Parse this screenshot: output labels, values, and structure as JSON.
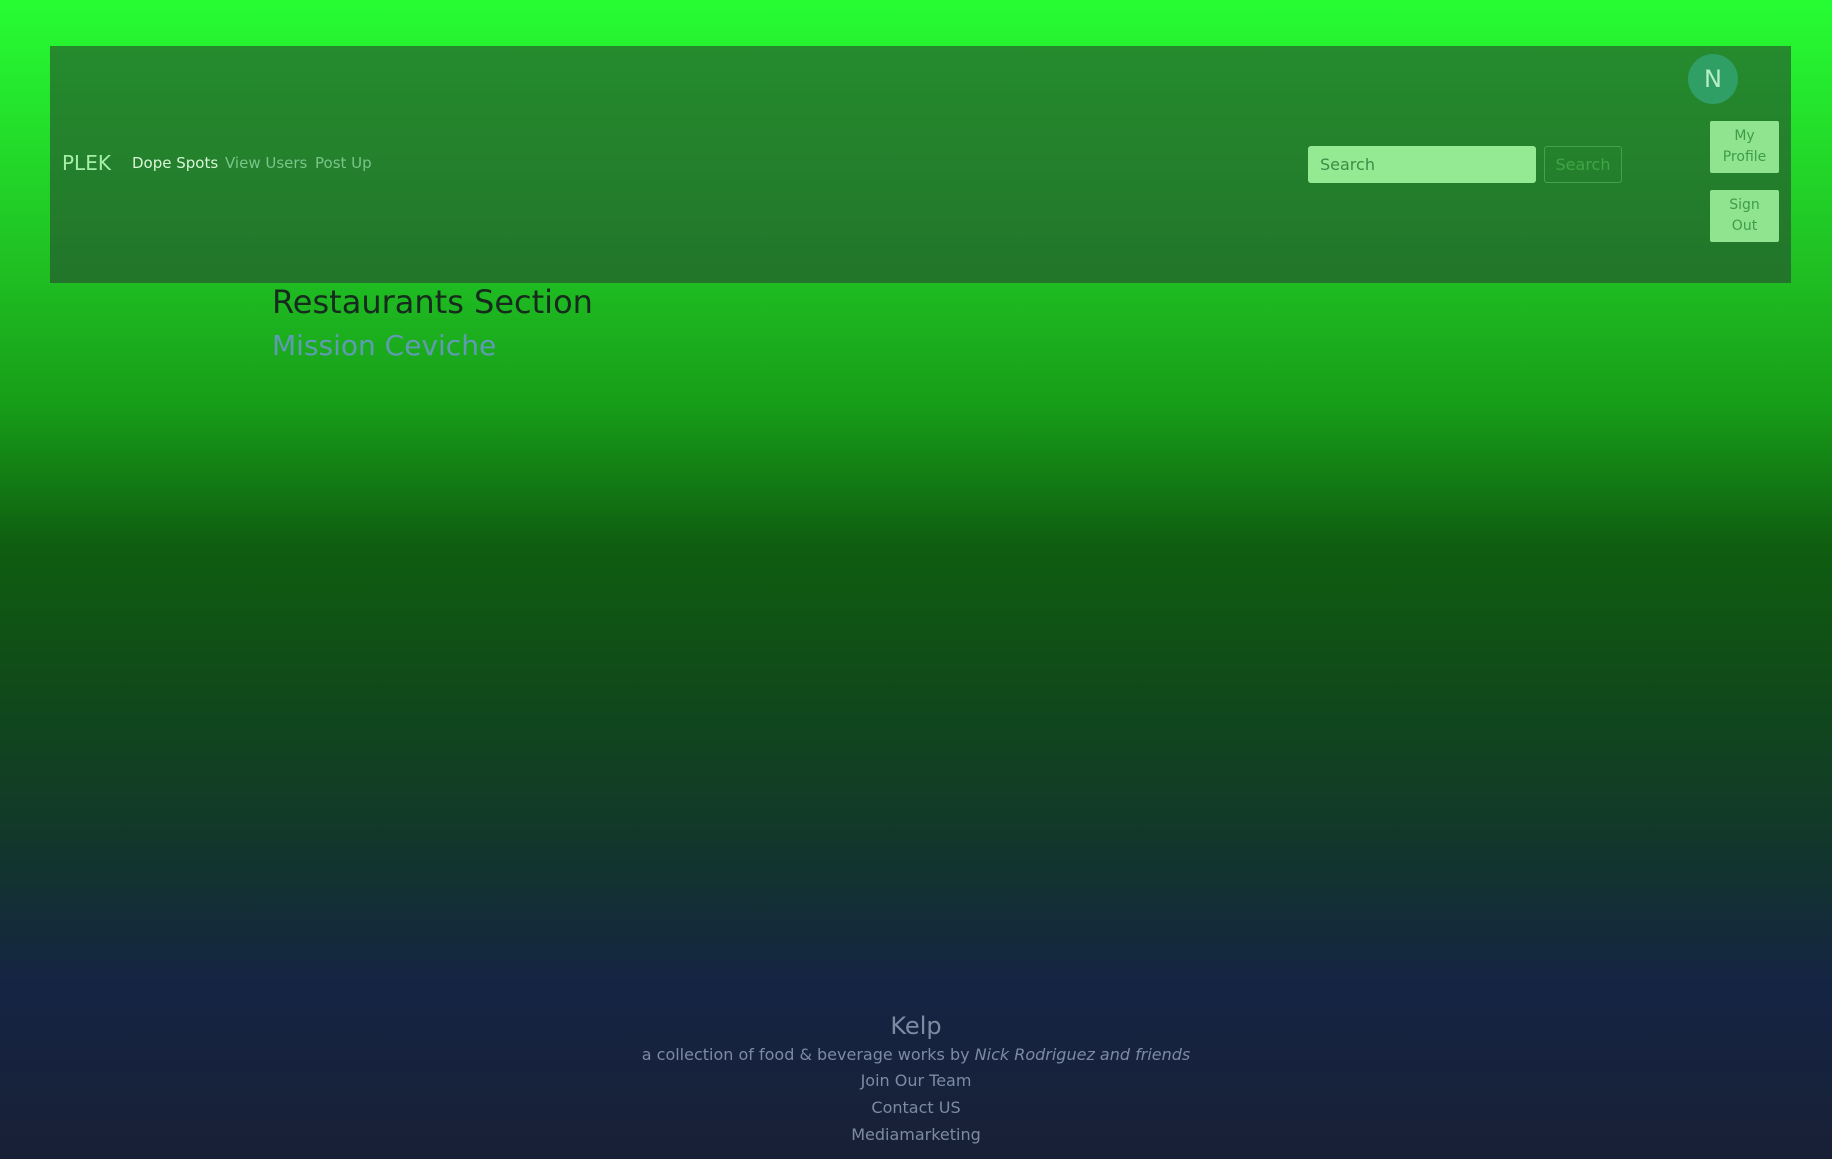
{
  "navbar": {
    "brand": "PLEK",
    "links": [
      {
        "label": "Dope Spots",
        "active": true
      },
      {
        "label": "View Users",
        "active": false
      },
      {
        "label": "Post Up",
        "active": false
      }
    ],
    "search": {
      "placeholder": "Search",
      "value": "",
      "button_label": "Search"
    },
    "avatar_initial": "N",
    "my_profile_label": "My Profile",
    "sign_out_label": "Sign Out"
  },
  "main": {
    "section_title": "Restaurants Section",
    "restaurants": [
      {
        "name": "Mission Ceviche"
      }
    ]
  },
  "footer": {
    "title": "Kelp",
    "tagline_prefix": "a collection of food & beverage works by ",
    "tagline_author": "Nick Rodriguez and friends",
    "links": [
      "Join Our Team",
      "Contact US",
      "Mediamarketing"
    ]
  },
  "colors": {
    "page_top": "#27fd33",
    "page_bottom": "#182036",
    "navbar_bg": "#258b2d",
    "search_field_bg": "#94e993",
    "avatar_bg": "#2f9f66",
    "restaurant_link": "#5f9cb2",
    "footer_text": "#7c8ba2"
  }
}
